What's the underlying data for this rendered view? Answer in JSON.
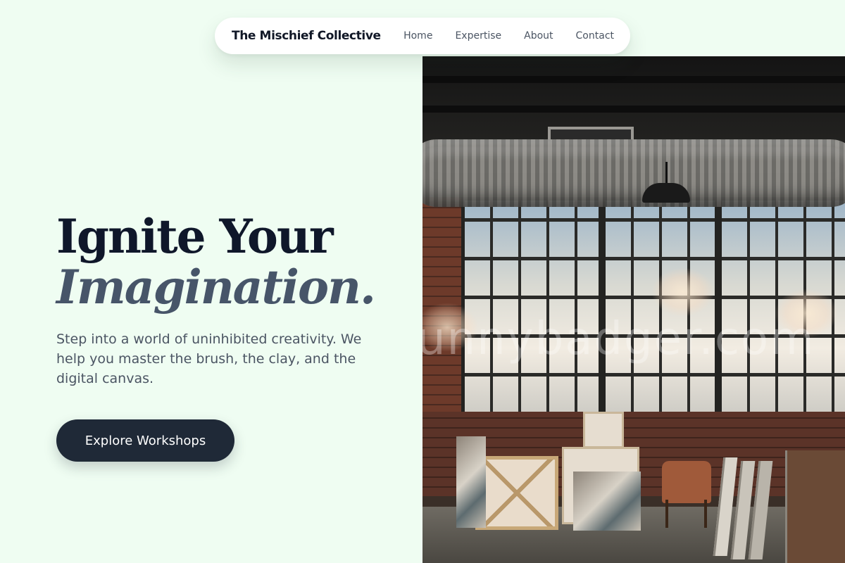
{
  "nav": {
    "brand": "The Mischief Collective",
    "links": [
      "Home",
      "Expertise",
      "About",
      "Contact"
    ]
  },
  "hero": {
    "headline_line1": "Ignite Your",
    "headline_line2": "Imagination.",
    "lede": "Step into a world of uninhibited creativity. We help you master the brush, the clay, and the digital canvas.",
    "cta_label": "Explore Workshops"
  },
  "image": {
    "subject": "art-studio-photo",
    "watermark_text": "unnybadger.com"
  },
  "colors": {
    "page_background": "#effdf2",
    "headline": "#0f172a",
    "headline_emphasis": "#475569",
    "button": "#1f2937",
    "button_text": "#ffffff"
  }
}
